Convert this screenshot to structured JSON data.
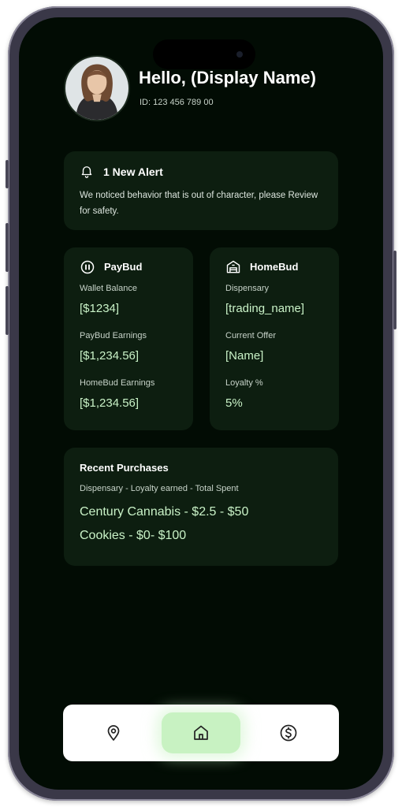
{
  "colors": {
    "background": "#020c04",
    "card": "#0d1e10",
    "accent_text": "#c9f2c7",
    "nav_active": "#c8f2c2"
  },
  "header": {
    "greeting": "Hello, (Display Name)",
    "user_id": "ID: 123 456 789 00",
    "avatar_icon": "profile-photo"
  },
  "alert": {
    "icon": "bell-icon",
    "title": "1 New Alert",
    "body": "We noticed behavior that is out of character, please Review for safety."
  },
  "paybud": {
    "icon": "wallet-icon",
    "title": "PayBud",
    "wallet_balance_label": "Wallet Balance",
    "wallet_balance_value": "[$1234]",
    "paybud_earnings_label": "PayBud Earnings",
    "paybud_earnings_value": "[$1,234.56]",
    "homebud_earnings_label": "HomeBud Earnings",
    "homebud_earnings_value": "[$1,234.56]"
  },
  "homebud": {
    "icon": "store-icon",
    "title": "HomeBud",
    "dispensary_label": "Dispensary",
    "dispensary_value": "[trading_name]",
    "current_offer_label": "Current Offer",
    "current_offer_value": "[Name]",
    "loyalty_label": "Loyalty %",
    "loyalty_value": "5%"
  },
  "recent_purchases": {
    "title": "Recent Purchases",
    "columns": "Dispensary - Loyalty earned - Total Spent",
    "items": [
      "Century Cannabis - $2.5 - $50",
      "Cookies - $0- $100"
    ]
  },
  "bottom_nav": {
    "items": [
      {
        "icon": "location-pin-icon",
        "active": false
      },
      {
        "icon": "home-icon",
        "active": true
      },
      {
        "icon": "dollar-icon",
        "active": false
      }
    ]
  }
}
